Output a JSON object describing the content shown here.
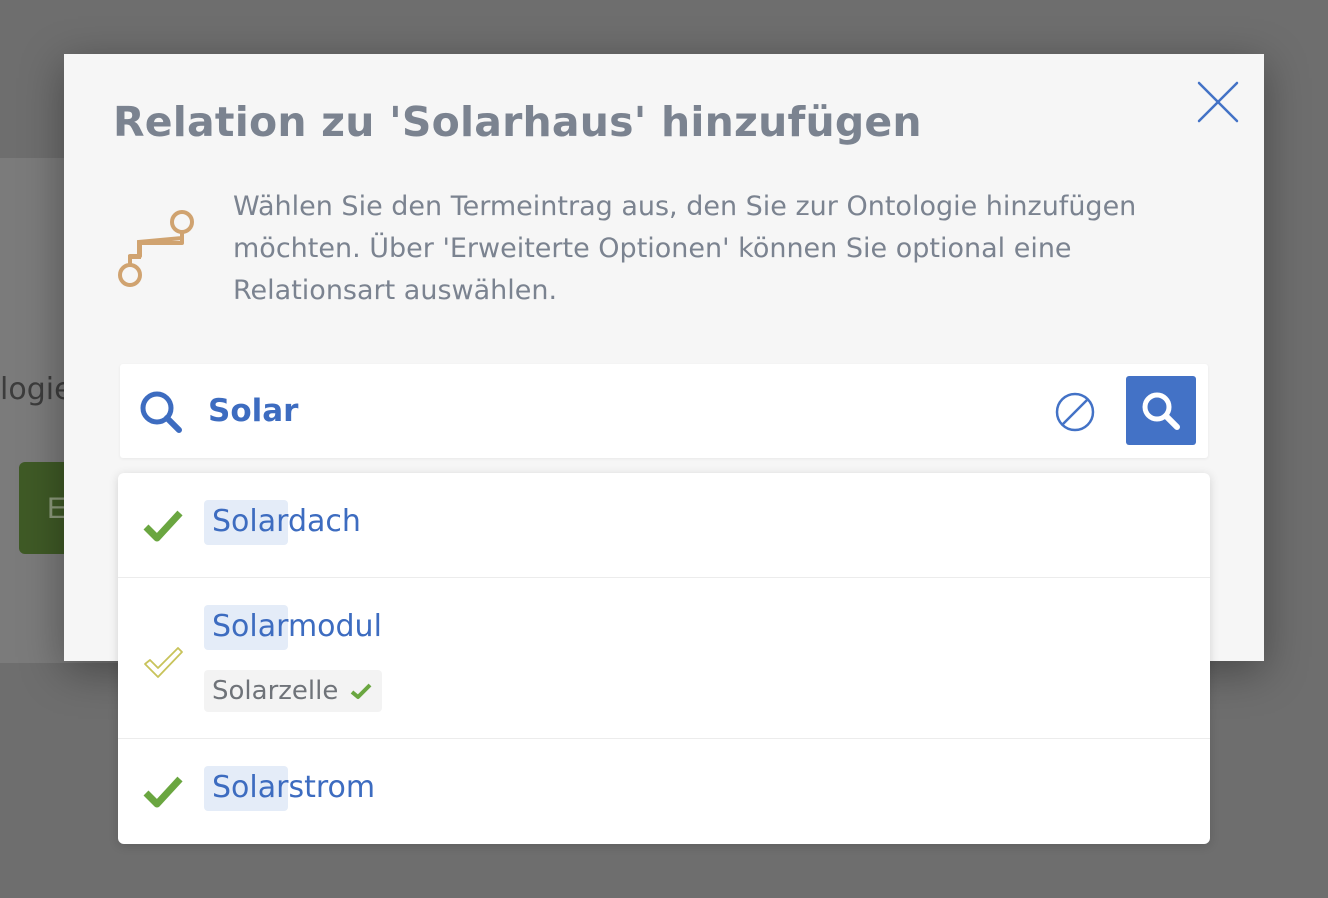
{
  "background": {
    "partial_text": "logie",
    "partial_button_label": "E"
  },
  "modal": {
    "title": "Relation zu 'Solarhaus' hinzufügen",
    "description": "Wählen Sie den Termeintrag aus, den Sie zur Ontologie hinzufügen möchten. Über 'Erweiterte Optionen' können Sie optional eine Relationsart auswählen.",
    "close_icon": "close-icon",
    "description_icon": "relation-path-icon"
  },
  "search": {
    "value": "Solar",
    "leading_icon": "search-icon",
    "clear_icon": "clear-icon",
    "submit_icon": "search-icon"
  },
  "results": [
    {
      "match": "Solar",
      "rest": "dach",
      "status": "confirmed"
    },
    {
      "match": "Solar",
      "rest": "modul",
      "status": "unconfirmed",
      "synonym": "Solarzelle",
      "synonym_status": "confirmed"
    },
    {
      "match": "Solar",
      "rest": "strom",
      "status": "confirmed"
    }
  ],
  "colors": {
    "accent": "#4372c6",
    "text_link": "#3d6cc0",
    "title": "#7b8390",
    "check_confirmed": "#6aa640",
    "check_unconfirmed": "#c8c35a",
    "relation_icon": "#d0a370",
    "match_highlight": "#e4ecf8"
  }
}
